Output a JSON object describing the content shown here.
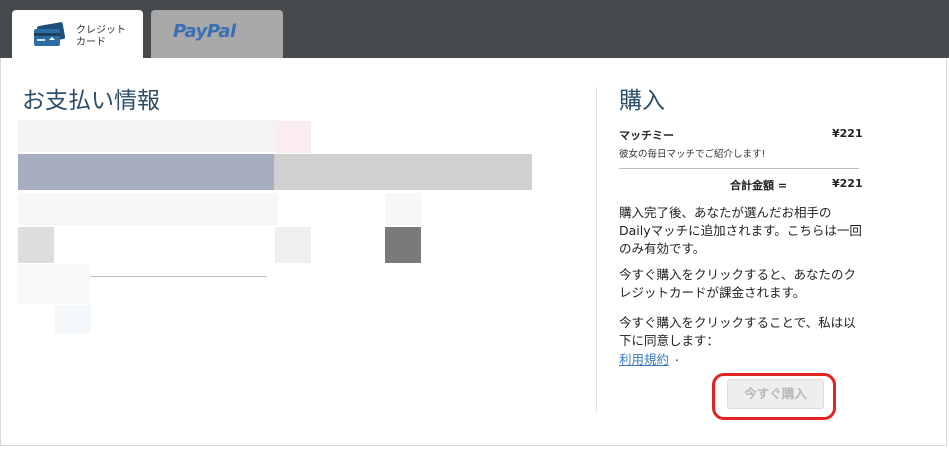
{
  "tabs": {
    "credit_card": {
      "label_line1": "クレジット",
      "label_line2": "カード"
    },
    "paypal": {
      "label": "PayPal"
    }
  },
  "payment": {
    "title": "お支払い情報"
  },
  "purchase": {
    "title": "購入",
    "item": {
      "name": "マッチミー",
      "price": "¥221",
      "description": "彼女の毎日マッチでご紹介します!"
    },
    "total": {
      "label": "合計金額 =",
      "price": "¥221"
    },
    "paragraphs": [
      "購入完了後、あなたが選んだお相手のDailyマッチに追加されます。こちらは一回のみ有効です。",
      "今すぐ購入をクリックすると、あなたのクレジットカードが課金されます。",
      "今すぐ購入をクリックすることで、私は以下に同意します："
    ],
    "terms_link": "利用規約",
    "terms_suffix": ".",
    "buy_button": "今すぐ購入"
  },
  "colors": {
    "accent": "#e02323",
    "title": "#2d4e6a",
    "link": "#3a7bbf",
    "topbar": "#464a4c"
  }
}
